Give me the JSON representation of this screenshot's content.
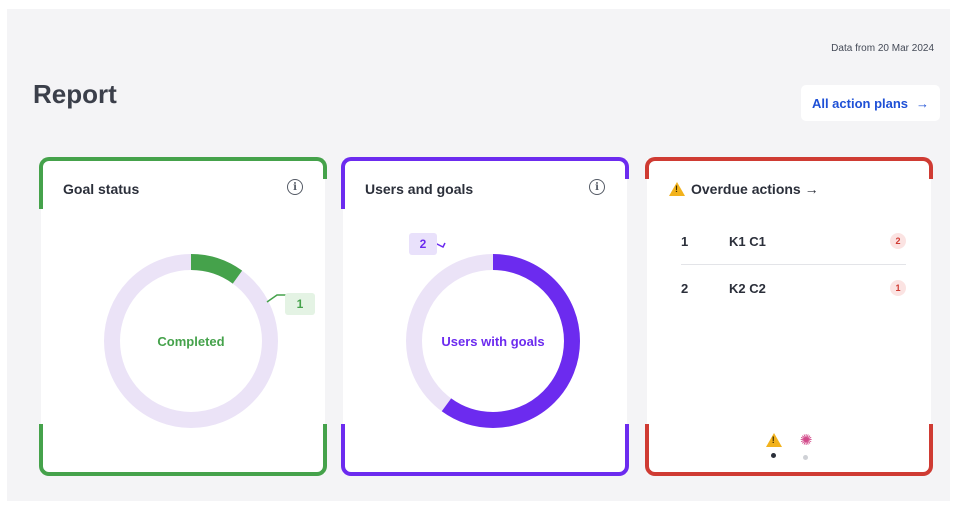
{
  "header": {
    "data_date": "Data from 20 Mar 2024",
    "title": "Report",
    "all_plans_label": "All action plans",
    "all_plans_arrow": "→"
  },
  "colors": {
    "green": "#45a24b",
    "purple": "#6c2bef",
    "red": "#cf3b33",
    "track": "#ebe3f7",
    "link": "#1e50d6"
  },
  "goal_status": {
    "title": "Goal status",
    "info_glyph": "i",
    "center_label": "Completed",
    "value_label": "1",
    "filled_fraction": 0.1
  },
  "users_goals": {
    "title": "Users and goals",
    "info_glyph": "i",
    "center_label": "Users with goals",
    "value_label": "2",
    "filled_fraction": 0.6
  },
  "overdue": {
    "title": "Overdue actions →",
    "rows": [
      {
        "num": "1",
        "name": "K1 C1",
        "count": "2"
      },
      {
        "num": "2",
        "name": "K2 C2",
        "count": "1"
      }
    ],
    "pager": [
      {
        "icon": "warning-icon",
        "active": true
      },
      {
        "icon": "party-popper-icon",
        "active": false
      }
    ]
  }
}
